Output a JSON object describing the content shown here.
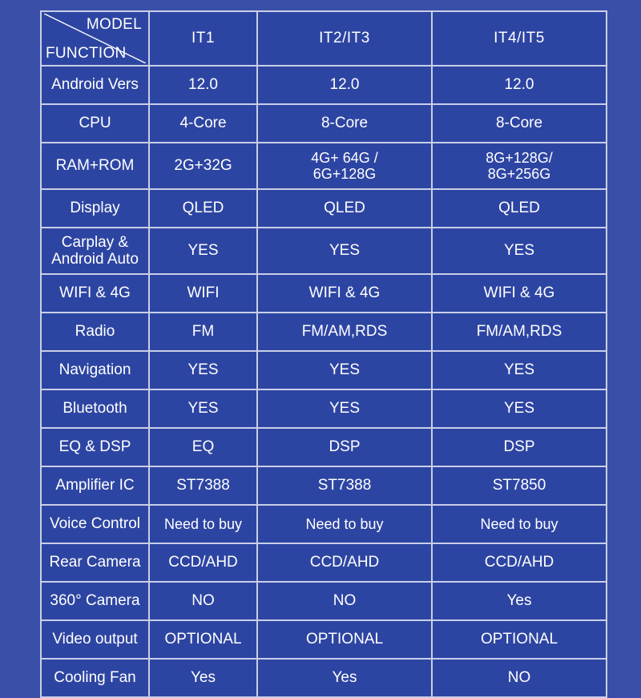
{
  "table": {
    "corner": {
      "model_label": "MODEL",
      "function_label": "FUNCTION"
    },
    "columns": [
      {
        "key": "func",
        "label": ""
      },
      {
        "key": "it1",
        "label": "IT1"
      },
      {
        "key": "it23",
        "label": "IT2/IT3"
      },
      {
        "key": "it45",
        "label": "IT4/IT5"
      }
    ],
    "rows": [
      {
        "label": "Android Vers",
        "values": [
          "12.0",
          "12.0",
          "12.0"
        ],
        "highlight": [
          false,
          false,
          false
        ],
        "multiline": false
      },
      {
        "label": "CPU",
        "values": [
          "4-Core",
          "8-Core",
          "8-Core"
        ],
        "highlight": [
          false,
          false,
          false
        ],
        "multiline": false
      },
      {
        "label": "RAM+ROM",
        "values": [
          "2G+32G",
          "4G+ 64G /\n6G+128G",
          "8G+128G/\n8G+256G"
        ],
        "highlight": [
          false,
          false,
          false
        ],
        "multiline": true
      },
      {
        "label": "Display",
        "values": [
          "QLED",
          "QLED",
          "QLED"
        ],
        "highlight": [
          true,
          true,
          true
        ],
        "multiline": false
      },
      {
        "label": "Carplay &\nAndroid Auto",
        "values": [
          "YES",
          "YES",
          "YES"
        ],
        "highlight": [
          false,
          false,
          false
        ],
        "multiline": true
      },
      {
        "label": "WIFI & 4G",
        "values": [
          "WIFI",
          "WIFI & 4G",
          "WIFI & 4G"
        ],
        "highlight": [
          false,
          false,
          false
        ],
        "multiline": false
      },
      {
        "label": "Radio",
        "values": [
          "FM",
          "FM/AM,RDS",
          "FM/AM,RDS"
        ],
        "highlight": [
          false,
          false,
          false
        ],
        "multiline": false
      },
      {
        "label": "Navigation",
        "values": [
          "YES",
          "YES",
          "YES"
        ],
        "highlight": [
          false,
          false,
          false
        ],
        "multiline": false
      },
      {
        "label": "Bluetooth",
        "values": [
          "YES",
          "YES",
          "YES"
        ],
        "highlight": [
          false,
          false,
          false
        ],
        "multiline": false
      },
      {
        "label": "EQ & DSP",
        "values": [
          "EQ",
          "DSP",
          "DSP"
        ],
        "highlight": [
          false,
          false,
          false
        ],
        "multiline": false
      },
      {
        "label": "Amplifier IC",
        "values": [
          "ST7388",
          "ST7388",
          "ST7850"
        ],
        "highlight": [
          false,
          false,
          false
        ],
        "multiline": false
      },
      {
        "label": "Voice Control",
        "values": [
          "Need to buy",
          "Need to buy",
          "Need to buy"
        ],
        "highlight": [
          false,
          false,
          false
        ],
        "multiline": false
      },
      {
        "label": "Rear Camera",
        "values": [
          "CCD/AHD",
          "CCD/AHD",
          "CCD/AHD"
        ],
        "highlight": [
          false,
          false,
          false
        ],
        "multiline": false
      },
      {
        "label": "360° Camera",
        "values": [
          "NO",
          "NO",
          "Yes"
        ],
        "highlight": [
          false,
          false,
          true
        ],
        "multiline": false
      },
      {
        "label": "Video output",
        "values": [
          "OPTIONAL",
          "OPTIONAL",
          "OPTIONAL"
        ],
        "highlight": [
          false,
          false,
          false
        ],
        "multiline": false
      },
      {
        "label": "Cooling Fan",
        "values": [
          "Yes",
          "Yes",
          "NO"
        ],
        "highlight": [
          true,
          true,
          false
        ],
        "multiline": false
      }
    ]
  },
  "colors": {
    "background": "#3a4fa8",
    "cell": "#2d45a2",
    "grid": "#c9cfe8",
    "text": "#ffffff",
    "highlight": "#d4242e"
  }
}
